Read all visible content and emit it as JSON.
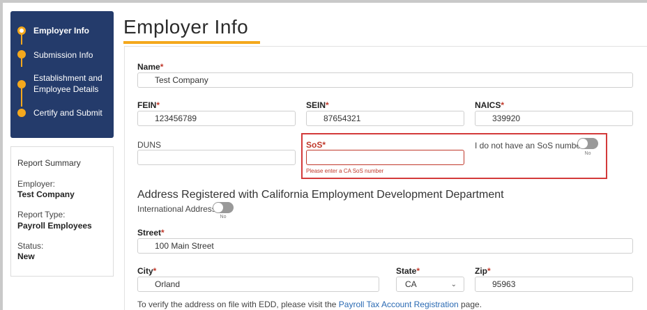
{
  "steps": [
    {
      "label": "Employer Info",
      "active": true
    },
    {
      "label": "Submission Info"
    },
    {
      "label": "Establishment and Employee Details"
    },
    {
      "label": "Certify and Submit"
    }
  ],
  "summary": {
    "title": "Report Summary",
    "employer_label": "Employer:",
    "employer_value": "Test Company",
    "report_type_label": "Report Type:",
    "report_type_value": "Payroll Employees",
    "status_label": "Status:",
    "status_value": "New"
  },
  "header": {
    "title": "Employer Info"
  },
  "form": {
    "name": {
      "label": "Name",
      "value": "Test Company"
    },
    "fein": {
      "label": "FEIN",
      "value": "123456789"
    },
    "sein": {
      "label": "SEIN",
      "value": "87654321"
    },
    "naics": {
      "label": "NAICS",
      "value": "339920"
    },
    "duns": {
      "label": "DUNS",
      "value": ""
    },
    "sos": {
      "label": "SoS",
      "value": "",
      "error": "Please enter a CA SoS number"
    },
    "no_sos": {
      "label": "I do not have an SoS number",
      "toggle_state": "No"
    },
    "required_mark": "*",
    "address_heading": "Address Registered with California Employment Development Department",
    "intl": {
      "label": "International Address",
      "toggle_state": "No"
    },
    "street": {
      "label": "Street",
      "value": "100 Main Street"
    },
    "city": {
      "label": "City",
      "value": "Orland"
    },
    "state": {
      "label": "State",
      "value": "CA"
    },
    "zip": {
      "label": "Zip",
      "value": "95963"
    },
    "verify_prefix": "To verify the address on file with EDD, please visit the ",
    "verify_link": "Payroll Tax Account Registration",
    "verify_suffix": " page."
  },
  "colors": {
    "navy": "#243b6b",
    "accent": "#f4a81d",
    "error": "#c0392b",
    "link": "#2a6ab3"
  }
}
